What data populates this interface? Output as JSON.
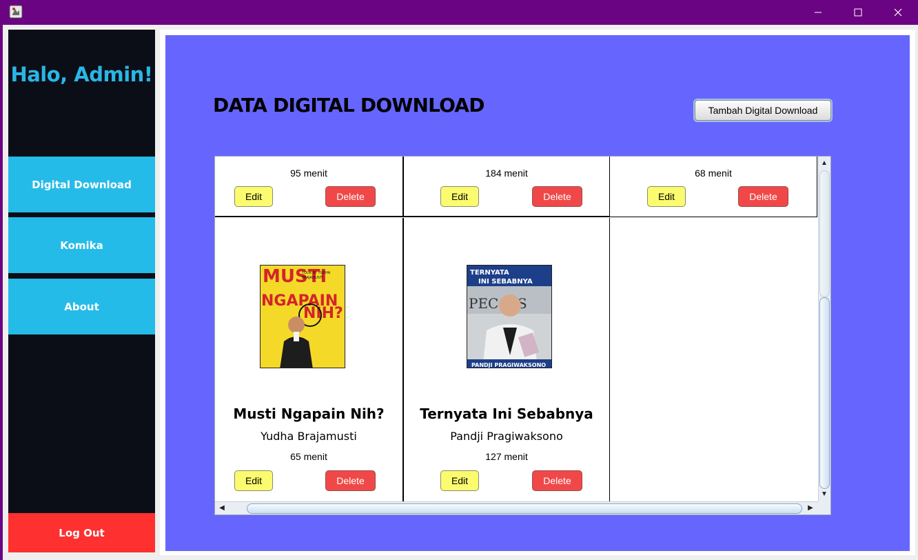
{
  "window": {
    "minimize_symbol": "—",
    "maximize_symbol": "☐",
    "close_symbol": "✕"
  },
  "sidebar": {
    "greeting": "Halo, Admin!",
    "items": [
      {
        "label": "Digital Download"
      },
      {
        "label": "Komika"
      },
      {
        "label": "About"
      }
    ],
    "logout_label": "Log Out"
  },
  "main": {
    "title": "DATA DIGITAL DOWNLOAD",
    "add_button": "Tambah Digital Download",
    "edit_label": "Edit",
    "delete_label": "Delete",
    "cards": [
      {
        "title": "",
        "author": "",
        "duration": "95 menit"
      },
      {
        "title": "",
        "author": "",
        "duration": "184 menit"
      },
      {
        "title": "",
        "author": "",
        "duration": "68 menit"
      },
      {
        "title": "Musti Ngapain Nih?",
        "author": "Yudha Brajamusti",
        "duration": "65 menit",
        "cover": {
          "line1": "MUSTI",
          "line2": "NGAPAIN",
          "line3": "NIH?",
          "tag": "TOUR BY YUDHA BRAJAMUSTI"
        }
      },
      {
        "title": "Ternyata Ini Sebabnya",
        "author": "Pandji Pragiwaksono",
        "duration": "127 menit",
        "cover": {
          "line1": "TERNYATA",
          "line2": "INI SEBABNYA",
          "tag": "PANDJI PRAGIWAKSONO"
        }
      }
    ]
  },
  "colors": {
    "sidebar_bg": "#0c0e17",
    "nav_accent": "#25bbe8",
    "logout": "#fe3030",
    "content_bg": "#6666ff",
    "edit_button": "#fbfb6f",
    "delete_button": "#f04848"
  },
  "scrollbars": {
    "up_arrow": "▲",
    "down_arrow": "▼",
    "left_arrow": "◀",
    "right_arrow": "▶"
  }
}
